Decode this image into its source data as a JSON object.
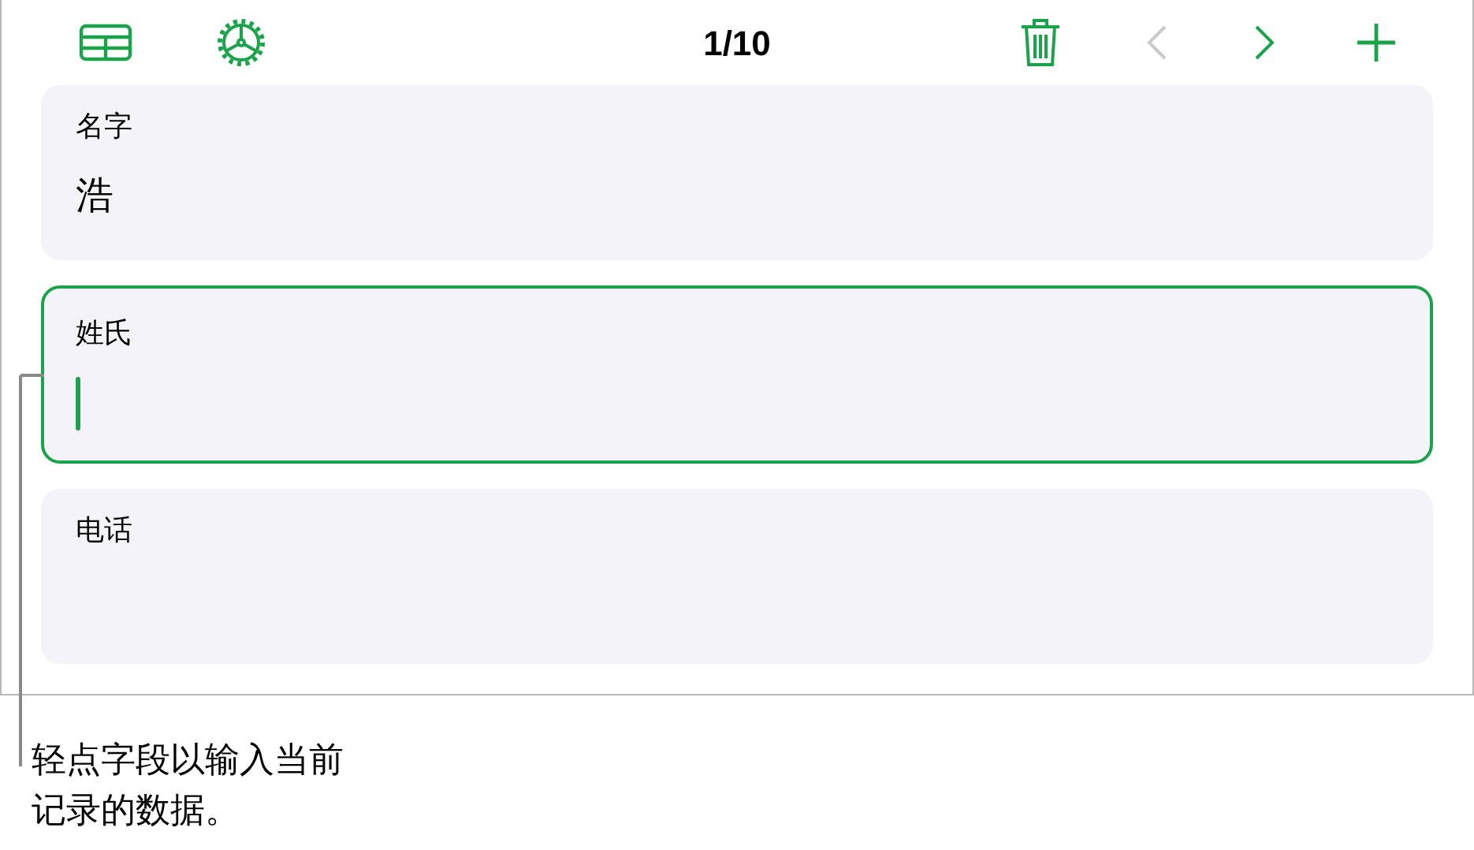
{
  "toolbar": {
    "record_counter": "1/10",
    "navigation": [
      {
        "kind": "previous",
        "disabled": true
      },
      {
        "kind": "next",
        "disabled": false
      }
    ]
  },
  "fields": [
    {
      "label": "名字",
      "value": "浩",
      "focused": false
    },
    {
      "label": "姓氏",
      "focused": true
    },
    {
      "label": "电话",
      "focused": false
    }
  ],
  "callout": {
    "text": "轻点字段以输入当前记录的数据。"
  }
}
